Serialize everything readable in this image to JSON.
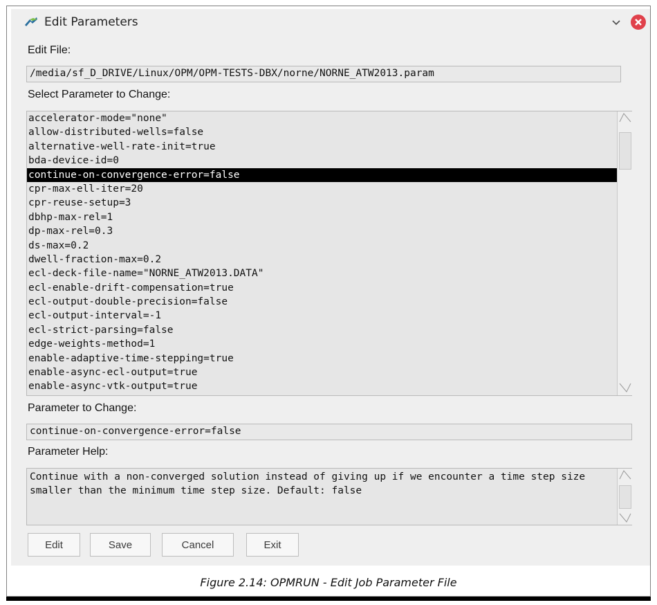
{
  "window": {
    "title": "Edit Parameters",
    "icon": "opm-app-icon"
  },
  "edit_file": {
    "label": "Edit File:",
    "value": "/media/sf_D_DRIVE/Linux/OPM/OPM-TESTS-DBX/norne/NORNE_ATW2013.param"
  },
  "select_label": "Select Parameter to Change:",
  "parameters": [
    "accelerator-mode=\"none\"",
    "allow-distributed-wells=false",
    "alternative-well-rate-init=true",
    "bda-device-id=0",
    "continue-on-convergence-error=false",
    "cpr-max-ell-iter=20",
    "cpr-reuse-setup=3",
    "dbhp-max-rel=1",
    "dp-max-rel=0.3",
    "ds-max=0.2",
    "dwell-fraction-max=0.2",
    "ecl-deck-file-name=\"NORNE_ATW2013.DATA\"",
    "ecl-enable-drift-compensation=true",
    "ecl-output-double-precision=false",
    "ecl-output-interval=-1",
    "ecl-strict-parsing=false",
    "edge-weights-method=1",
    "enable-adaptive-time-stepping=true",
    "enable-async-ecl-output=true",
    "enable-async-vtk-output=true"
  ],
  "selected_index": 4,
  "param_change": {
    "label": "Parameter to Change:",
    "value": "continue-on-convergence-error=false"
  },
  "help": {
    "label": "Parameter Help:",
    "text": "Continue with a non-converged solution instead of giving up if we encounter a time step size smaller than the minimum time step size. Default: false"
  },
  "buttons": {
    "edit": "Edit",
    "save": "Save",
    "cancel": "Cancel",
    "exit": "Exit"
  },
  "caption": "Figure 2.14: OPMRUN -  Edit Job Parameter File",
  "colors": {
    "selection_bg": "#000000",
    "close_button": "#e0414b",
    "window_bg": "#efefef"
  }
}
